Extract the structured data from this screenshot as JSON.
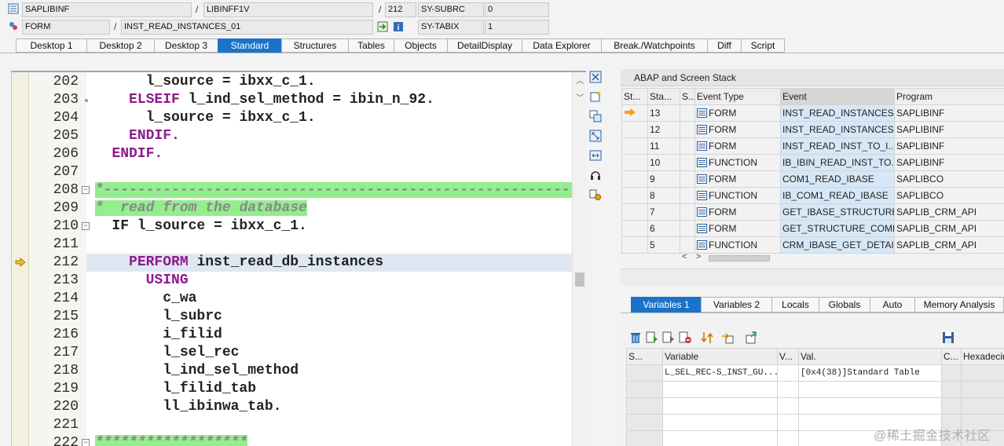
{
  "header": {
    "program": "SAPLIBINF",
    "include": "LIBINFF1V",
    "line": "212",
    "sysfield1_name": "SY-SUBRC",
    "sysfield1_value": "0",
    "event_type": "FORM",
    "event_name": "INST_READ_INSTANCES_01",
    "sysfield2_name": "SY-TABIX",
    "sysfield2_value": "1",
    "slash": "/"
  },
  "tabs": [
    "Desktop 1",
    "Desktop 2",
    "Desktop 3",
    "Standard",
    "Structures",
    "Tables",
    "Objects",
    "DetailDisplay",
    "Data Explorer",
    "Break./Watchpoints",
    "Diff",
    "Script"
  ],
  "editor": {
    "lines": [
      {
        "num": "202",
        "pre": "      ",
        "kw": "",
        "text": "l_source = ibxx_c_1."
      },
      {
        "num": "203",
        "pre": "    ",
        "kw": "ELSEIF",
        "text": " l_ind_sel_method = ibin_n_92."
      },
      {
        "num": "204",
        "pre": "      ",
        "kw": "",
        "text": "l_source = ibxx_c_1."
      },
      {
        "num": "205",
        "pre": "    ",
        "kw": "ENDIF.",
        "text": ""
      },
      {
        "num": "206",
        "pre": "  ",
        "kw": "ENDIF.",
        "text": ""
      },
      {
        "num": "207",
        "pre": "",
        "kw": "",
        "text": ""
      },
      {
        "num": "208",
        "pre": "",
        "kw": "",
        "text": "",
        "comment": "*-----------------------------------------------------------"
      },
      {
        "num": "209",
        "pre": "",
        "kw": "",
        "text": "",
        "comment": "*  read from the database"
      },
      {
        "num": "210",
        "pre": "  ",
        "kw": "",
        "text": "IF l_source = ibxx_c_1."
      },
      {
        "num": "211",
        "pre": "",
        "kw": "",
        "text": ""
      },
      {
        "num": "212",
        "pre": "    ",
        "kw": "PERFORM",
        "text": " inst_read_db_instances"
      },
      {
        "num": "213",
        "pre": "      ",
        "kw": "USING",
        "text": ""
      },
      {
        "num": "214",
        "pre": "        ",
        "kw": "",
        "text": "c_wa"
      },
      {
        "num": "215",
        "pre": "        ",
        "kw": "",
        "text": "l_subrc"
      },
      {
        "num": "216",
        "pre": "        ",
        "kw": "",
        "text": "i_filid"
      },
      {
        "num": "217",
        "pre": "        ",
        "kw": "",
        "text": "l_sel_rec"
      },
      {
        "num": "218",
        "pre": "        ",
        "kw": "",
        "text": "l_ind_sel_method"
      },
      {
        "num": "219",
        "pre": "        ",
        "kw": "",
        "text": "l_filid_tab"
      },
      {
        "num": "220",
        "pre": "        ",
        "kw": "",
        "text": "ll_ibinwa_tab."
      },
      {
        "num": "221",
        "pre": "",
        "kw": "",
        "text": ""
      },
      {
        "num": "222",
        "pre": "",
        "kw": "",
        "text": "",
        "comment": "******************"
      }
    ]
  },
  "stack": {
    "title": "ABAP and Screen Stack",
    "columns": [
      "St...",
      "Sta...",
      "S...",
      "Event Type",
      "Event",
      "Program"
    ],
    "rows": [
      {
        "level": "13",
        "type": "FORM",
        "event": "INST_READ_INSTANCES...",
        "program": "SAPLIBINF"
      },
      {
        "level": "12",
        "type": "FORM",
        "event": "INST_READ_INSTANCES...",
        "program": "SAPLIBINF"
      },
      {
        "level": "11",
        "type": "FORM",
        "event": "INST_READ_INST_TO_I...",
        "program": "SAPLIBINF"
      },
      {
        "level": "10",
        "type": "FUNCTION",
        "event": "IB_IBIN_READ_INST_TO...",
        "program": "SAPLIBINF"
      },
      {
        "level": "9",
        "type": "FORM",
        "event": "COM1_READ_IBASE",
        "program": "SAPLIBCO"
      },
      {
        "level": "8",
        "type": "FUNCTION",
        "event": "IB_COM1_READ_IBASE",
        "program": "SAPLIBCO"
      },
      {
        "level": "7",
        "type": "FORM",
        "event": "GET_IBASE_STRUCTURE",
        "program": "SAPLIB_CRM_API"
      },
      {
        "level": "6",
        "type": "FORM",
        "event": "GET_STRUCTURE_COMP...",
        "program": "SAPLIB_CRM_API"
      },
      {
        "level": "5",
        "type": "FUNCTION",
        "event": "CRM_IBASE_GET_DETAIL",
        "program": "SAPLIB_CRM_API"
      }
    ]
  },
  "vartabs": [
    "Variables 1",
    "Variables 2",
    "Locals",
    "Globals",
    "Auto",
    "Memory Analysis"
  ],
  "variables": {
    "columns": [
      "S...",
      "Variable",
      "V...",
      "Val.",
      "C...",
      "Hexadecimal"
    ],
    "rows": [
      {
        "variable": "L_SEL_REC-S_INST_GU...",
        "value": "[0x4(38)]Standard Table"
      }
    ]
  },
  "watermark": "@稀土掘金技术社区",
  "colors": {
    "accent": "#1a73c8",
    "keyword": "#8e1a8e",
    "comment_bg": "#93ee8d",
    "current_line": "#dfe8f2"
  }
}
